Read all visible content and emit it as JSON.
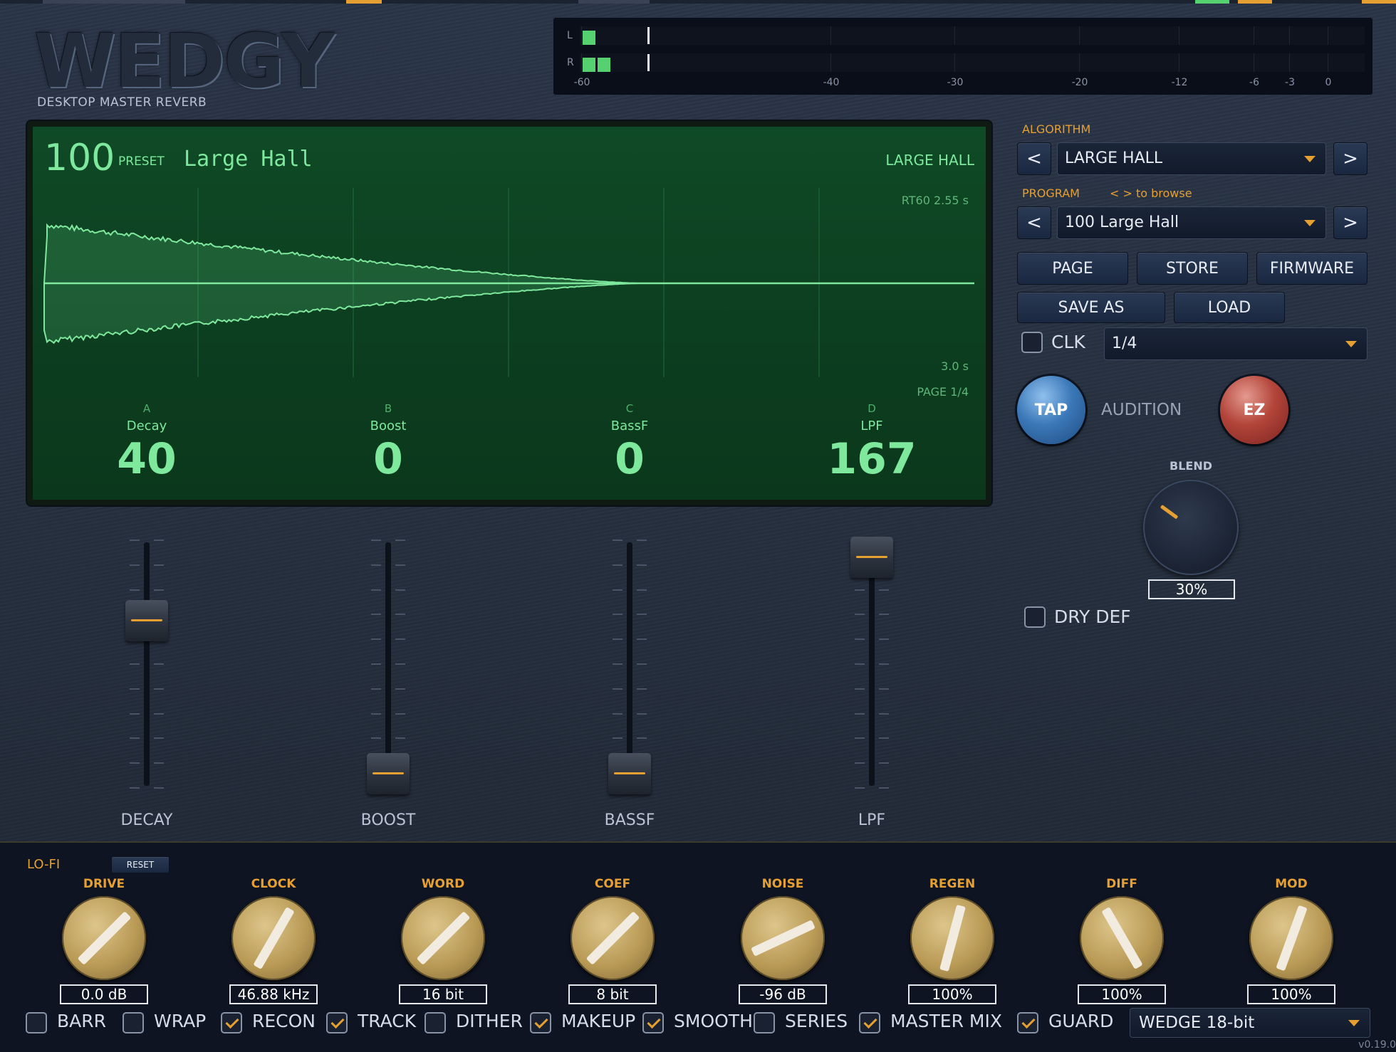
{
  "header": {
    "logo": "WEDGY",
    "subtitle": "DESKTOP MASTER REVERB"
  },
  "meter": {
    "channels": [
      {
        "label": "L",
        "level_segments": 1
      },
      {
        "label": "R",
        "level_segments": 2
      }
    ],
    "scale": [
      "-60",
      "-40",
      "-30",
      "-20",
      "-12",
      "-6",
      "-3",
      "0"
    ]
  },
  "display": {
    "preset_number": "100",
    "preset_tag": "PRESET",
    "preset_name": "Large Hall",
    "algorithm": "LARGE HALL",
    "rt60": "RT60 2.55 s",
    "time_scale": "3.0 s",
    "page": "PAGE 1/4",
    "params": [
      {
        "letter": "A",
        "name": "Decay",
        "value": "40"
      },
      {
        "letter": "B",
        "name": "Boost",
        "value": "0"
      },
      {
        "letter": "C",
        "name": "BassF",
        "value": "0"
      },
      {
        "letter": "D",
        "name": "LPF",
        "value": "167"
      }
    ]
  },
  "algorithm": {
    "label": "ALGORITHM",
    "value": "LARGE HALL",
    "prev": "<",
    "next": ">"
  },
  "program": {
    "label": "PROGRAM",
    "hint": "< >  to browse",
    "value": "100  Large Hall",
    "prev": "<",
    "next": ">"
  },
  "buttons": {
    "page": "PAGE",
    "store": "STORE",
    "firmware": "FIRMWARE",
    "save_as": "SAVE AS",
    "load": "LOAD"
  },
  "clk": {
    "label": "CLK",
    "checked": false,
    "value": "1/4"
  },
  "tap": {
    "label": "TAP",
    "audition": "AUDITION",
    "ez": "EZ"
  },
  "blend": {
    "label": "BLEND",
    "value": "30%"
  },
  "dry_def": {
    "label": "DRY DEF",
    "checked": false
  },
  "faders": [
    {
      "label": "DECAY",
      "position": 0.6
    },
    {
      "label": "BOOST",
      "position": 0.0
    },
    {
      "label": "BASSF",
      "position": 0.0
    },
    {
      "label": "LPF",
      "position": 0.85
    }
  ],
  "lofi": {
    "title": "LO-FI",
    "reset": "RESET",
    "knobs": [
      {
        "label": "DRIVE",
        "value": "0.0 dB",
        "angle": 45
      },
      {
        "label": "CLOCK",
        "value": "46.88 kHz",
        "angle": 30
      },
      {
        "label": "WORD",
        "value": "16 bit",
        "angle": 45
      },
      {
        "label": "COEF",
        "value": "8 bit",
        "angle": 45
      },
      {
        "label": "NOISE",
        "value": "-96 dB",
        "angle": 65
      },
      {
        "label": "REGEN",
        "value": "100%",
        "angle": 15
      },
      {
        "label": "DIFF",
        "value": "100%",
        "angle": -30
      },
      {
        "label": "MOD",
        "value": "100%",
        "angle": 20
      }
    ],
    "options": [
      {
        "label": "BARR",
        "checked": false
      },
      {
        "label": "WRAP",
        "checked": false
      },
      {
        "label": "RECON",
        "checked": true
      },
      {
        "label": "TRACK",
        "checked": true
      },
      {
        "label": "DITHER",
        "checked": false
      },
      {
        "label": "MAKEUP",
        "checked": true
      },
      {
        "label": "SMOOTH",
        "checked": true
      },
      {
        "label": "SERIES",
        "checked": false
      },
      {
        "label": "MASTER MIX",
        "checked": true
      },
      {
        "label": "GUARD",
        "checked": true
      }
    ],
    "mode": "WEDGE 18-bit"
  },
  "version": "v0.19.0",
  "colors": {
    "accent": "#e6a032",
    "lcd_green": "#7ee89c",
    "meter_green": "#55d16f"
  }
}
